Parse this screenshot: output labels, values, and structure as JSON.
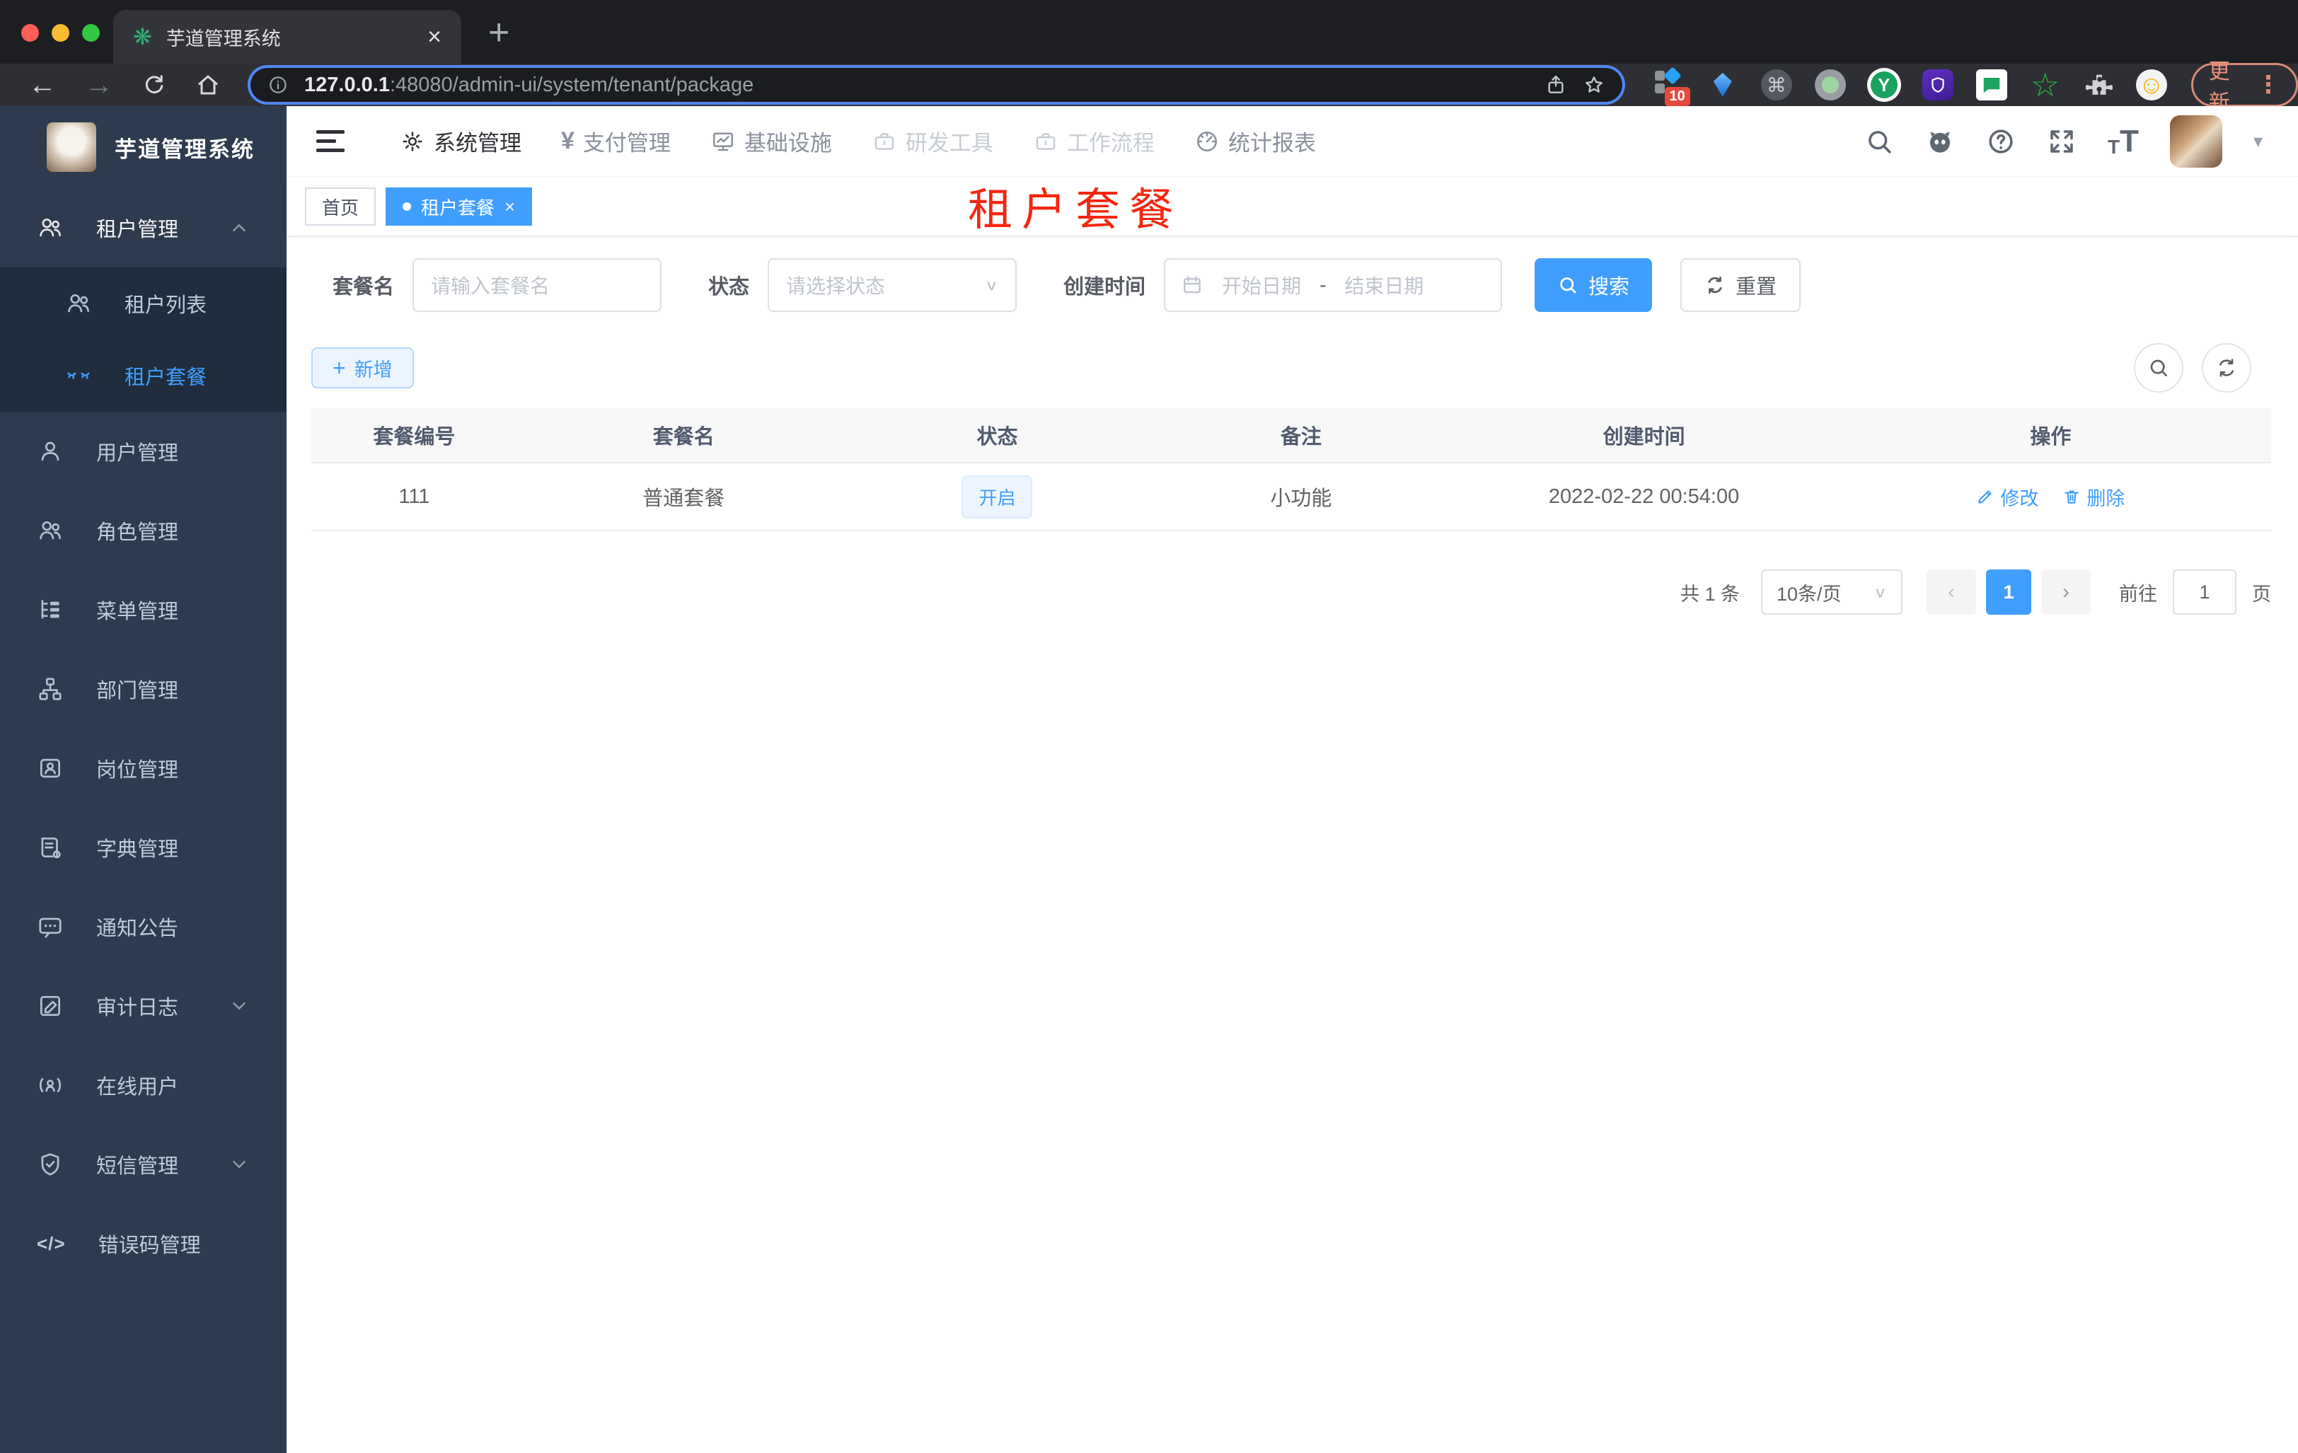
{
  "colors": {
    "accent": "#409eff",
    "sidebar_bg": "#2e3b4e",
    "submenu_bg": "#1f2d3d",
    "overlay_red": "#f5260f",
    "status_tag_bg": "#ecf5ff",
    "chrome_bg": "#1d1e21",
    "update_pill": "#ec927b"
  },
  "icons": {
    "tab_close": "×",
    "new_tab": "+",
    "back_arrow": "←",
    "forward_arrow": "→",
    "command": "⌘",
    "y_letter": "Y",
    "green_star": "☆",
    "smiley": "☺",
    "menu_dots": "⋮",
    "caret_down": "▾",
    "select_chevron": "∨",
    "prev": "‹",
    "next": "›",
    "plus": "+",
    "yen": "¥",
    "code": "</>",
    "tag_close": "×",
    "tag_dot": "●"
  },
  "browser": {
    "tab_title": "芋道管理系统",
    "url_host": "127.0.0.1",
    "url_rest": ":48080/admin-ui/system/tenant/package",
    "extension_badge": "10",
    "update_label": "更新"
  },
  "app": {
    "logo_title": "芋道管理系统",
    "topnav": {
      "items": [
        {
          "label": "系统管理"
        },
        {
          "label": "支付管理"
        },
        {
          "label": "基础设施"
        },
        {
          "label": "研发工具"
        },
        {
          "label": "工作流程"
        },
        {
          "label": "统计报表"
        }
      ]
    },
    "sidebar": {
      "items": [
        {
          "label": "租户管理"
        },
        {
          "label": "租户列表"
        },
        {
          "label": "租户套餐"
        },
        {
          "label": "用户管理"
        },
        {
          "label": "角色管理"
        },
        {
          "label": "菜单管理"
        },
        {
          "label": "部门管理"
        },
        {
          "label": "岗位管理"
        },
        {
          "label": "字典管理"
        },
        {
          "label": "通知公告"
        },
        {
          "label": "审计日志"
        },
        {
          "label": "在线用户"
        },
        {
          "label": "短信管理"
        },
        {
          "label": "错误码管理"
        }
      ]
    },
    "tags": [
      {
        "label": "首页"
      },
      {
        "label": "租户套餐"
      }
    ],
    "overlay_title": "租户套餐",
    "filters": {
      "name_label": "套餐名",
      "name_placeholder": "请输入套餐名",
      "status_label": "状态",
      "status_placeholder": "请选择状态",
      "date_label": "创建时间",
      "date_start": "开始日期",
      "date_sep": "-",
      "date_end": "结束日期",
      "search": "搜索",
      "reset": "重置"
    },
    "toolbar": {
      "add": "新增"
    },
    "table": {
      "headers": [
        "套餐编号",
        "套餐名",
        "状态",
        "备注",
        "创建时间",
        "操作"
      ],
      "rows": [
        {
          "id": "111",
          "name": "普通套餐",
          "status": "开启",
          "remark": "小功能",
          "created": "2022-02-22 00:54:00",
          "edit": "修改",
          "delete": "删除"
        }
      ]
    },
    "pagination": {
      "total": "共 1 条",
      "size": "10条/页",
      "page": "1",
      "goto": "前往",
      "goto_value": "1",
      "unit": "页"
    }
  }
}
